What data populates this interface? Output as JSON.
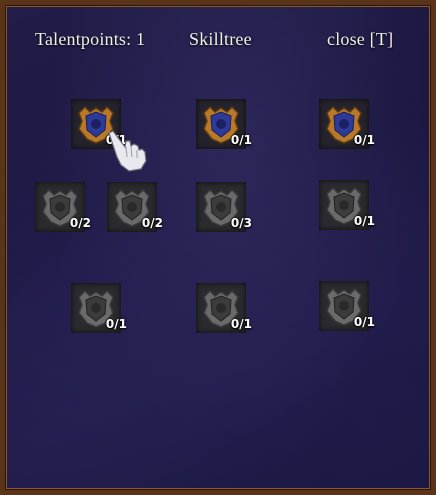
{
  "header": {
    "talentpoints": "Talentpoints: 1",
    "title": "Skilltree",
    "close": "close [T]"
  },
  "nodes": [
    {
      "id": "r1c1",
      "count": "0/1",
      "state": "active",
      "icon": "crest-gold-icon"
    },
    {
      "id": "r1c2",
      "count": "0/1",
      "state": "active",
      "icon": "crest-gold-icon"
    },
    {
      "id": "r1c3",
      "count": "0/1",
      "state": "active",
      "icon": "crest-gold-icon"
    },
    {
      "id": "r2c1",
      "count": "0/2",
      "state": "locked",
      "icon": "crest-grey-icon"
    },
    {
      "id": "r2c2",
      "count": "0/2",
      "state": "locked",
      "icon": "crest-grey-icon"
    },
    {
      "id": "r2c3",
      "count": "0/3",
      "state": "locked",
      "icon": "crest-grey-icon"
    },
    {
      "id": "r2c4",
      "count": "0/1",
      "state": "locked",
      "icon": "crest-grey-icon"
    },
    {
      "id": "r3c1",
      "count": "0/1",
      "state": "locked",
      "icon": "crest-grey-icon"
    },
    {
      "id": "r3c2",
      "count": "0/1",
      "state": "locked",
      "icon": "crest-grey-icon"
    },
    {
      "id": "r3c3",
      "count": "0/1",
      "state": "locked",
      "icon": "crest-grey-icon"
    }
  ],
  "colors": {
    "frame": "#5a3418",
    "background": "#1b1740",
    "crest_gold": "#b87a2a",
    "crest_grey": "#6a6a6a",
    "gem_blue": "#2d3a9a"
  }
}
